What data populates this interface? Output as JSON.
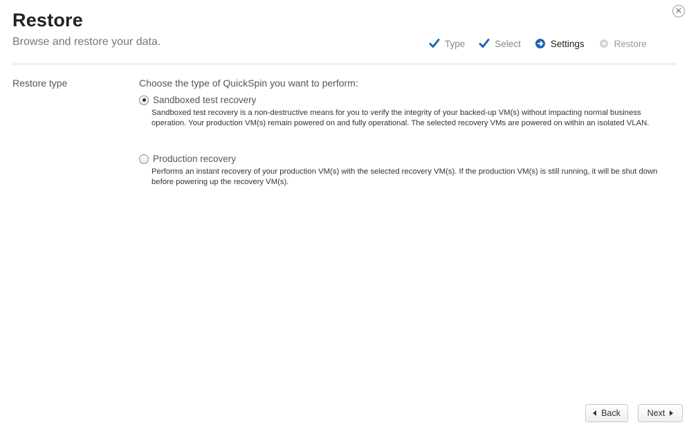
{
  "header": {
    "title": "Restore",
    "subtitle": "Browse and restore your data.",
    "close_icon": "close-icon"
  },
  "steps": [
    {
      "label": "Type",
      "state": "done",
      "icon": "check-icon"
    },
    {
      "label": "Select",
      "state": "done",
      "icon": "check-icon"
    },
    {
      "label": "Settings",
      "state": "current",
      "icon": "current-step-icon"
    },
    {
      "label": "Restore",
      "state": "pending",
      "icon": "pending-step-icon"
    }
  ],
  "colors": {
    "accent": "#1a66b3",
    "pending": "#d3d3d3"
  },
  "restore_type": {
    "label": "Restore type",
    "prompt": "Choose the type of QuickSpin you want to perform:",
    "options": [
      {
        "label": "Sandboxed test recovery",
        "checked": true,
        "description": "Sandboxed test recovery is a non-destructive means for you to verify the integrity of your backed-up VM(s) without impacting normal business operation.  Your production VM(s) remain powered on and fully operational.  The selected recovery VMs are powered on within an isolated VLAN."
      },
      {
        "label": "Production recovery",
        "checked": false,
        "description": "Performs an instant recovery of your production VM(s) with the selected recovery VM(s).  If the production VM(s) is still running, it will be shut down before powering up the recovery VM(s)."
      }
    ]
  },
  "footer": {
    "back_label": "Back",
    "next_label": "Next"
  }
}
